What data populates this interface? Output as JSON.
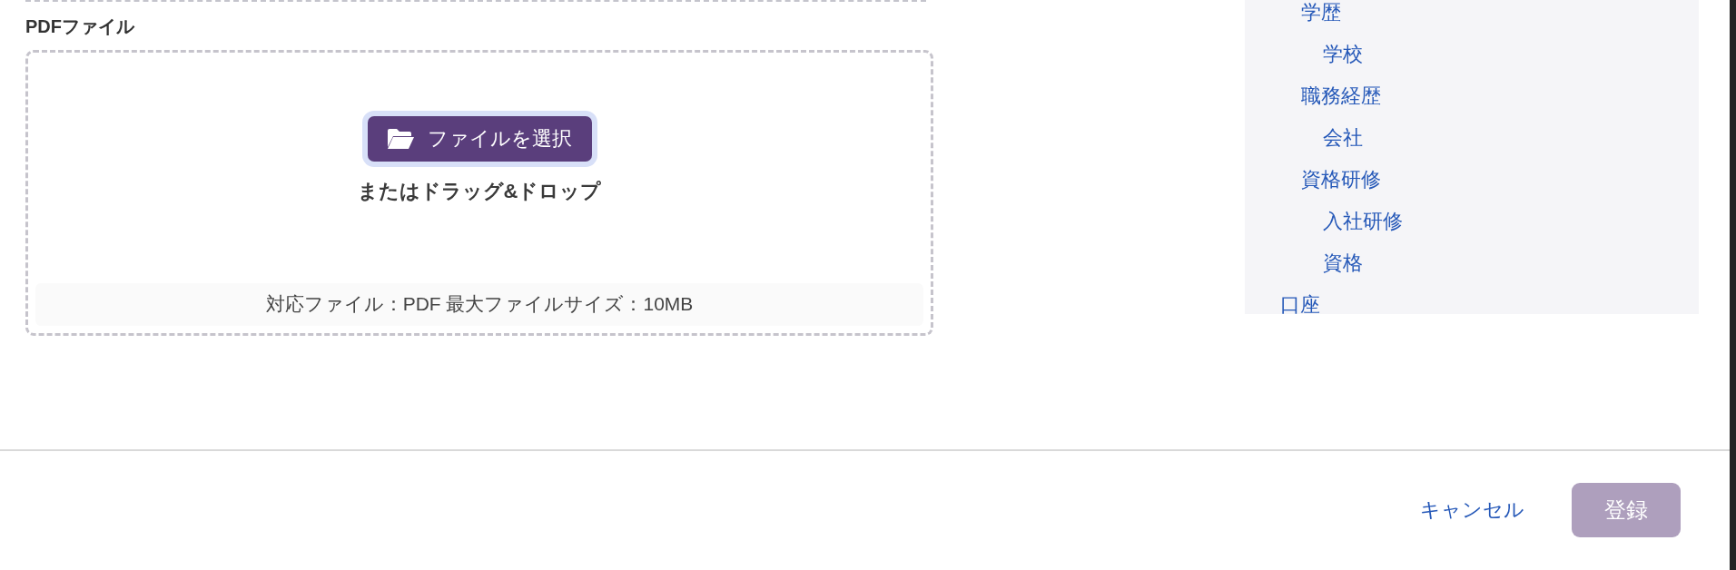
{
  "upload": {
    "label": "PDFファイル",
    "button": {
      "label": "ファイルを選択",
      "focused": true
    },
    "drop_hint": "またはドラッグ&ドロップ",
    "info": "対応ファイル：PDF 最大ファイルサイズ：10MB"
  },
  "outline": {
    "items": [
      {
        "label": "学歴",
        "children": [
          {
            "label": "学校"
          }
        ]
      },
      {
        "label": "職務経歴",
        "children": [
          {
            "label": "会社"
          }
        ]
      },
      {
        "label": "資格研修",
        "children": [
          {
            "label": "入社研修"
          },
          {
            "label": "資格"
          }
        ]
      }
    ],
    "root_items": [
      {
        "label": "口座"
      }
    ]
  },
  "footer": {
    "cancel": "キャンセル",
    "submit": {
      "label": "登録",
      "disabled": true
    }
  }
}
